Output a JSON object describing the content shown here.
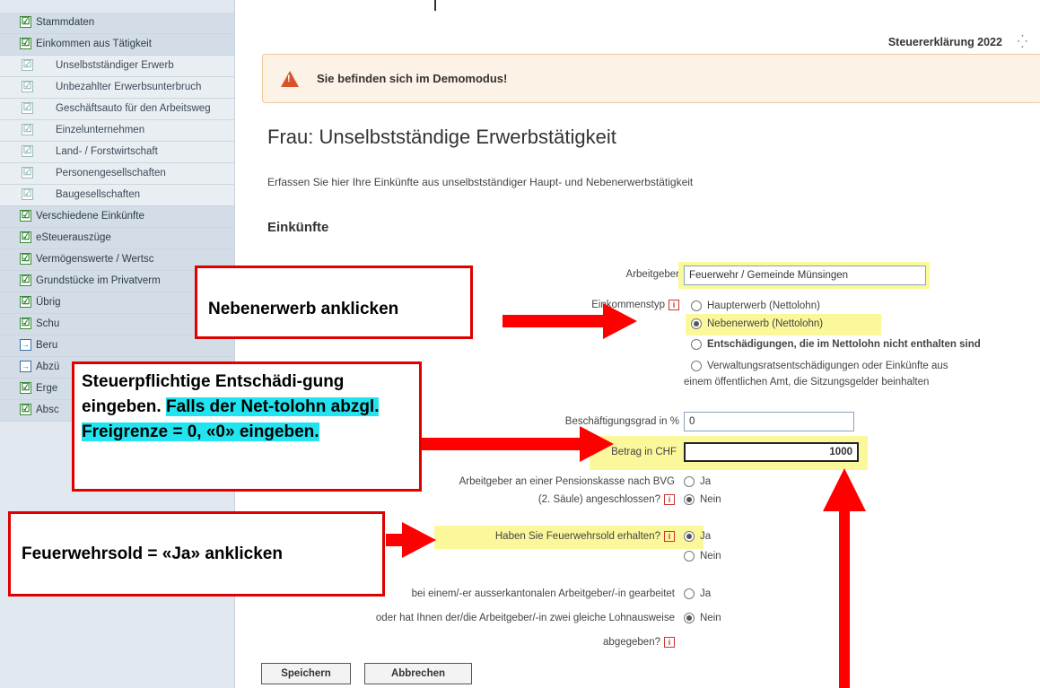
{
  "sidebar": {
    "items": [
      {
        "label": "Stammdaten",
        "level": "top",
        "mark": "☑"
      },
      {
        "label": "Einkommen aus Tätigkeit",
        "level": "top",
        "mark": "☑"
      },
      {
        "label": "Unselbstständiger Erwerb",
        "level": "sub",
        "mark": "☑"
      },
      {
        "label": "Unbezahlter Erwerbsunterbruch",
        "level": "sub",
        "mark": "☑"
      },
      {
        "label": "Geschäftsauto für den Arbeitsweg",
        "level": "sub",
        "mark": "☑"
      },
      {
        "label": "Einzelunternehmen",
        "level": "sub",
        "mark": "☑"
      },
      {
        "label": "Land- / Forstwirtschaft",
        "level": "sub",
        "mark": "☑"
      },
      {
        "label": "Personengesellschaften",
        "level": "sub",
        "mark": "☑"
      },
      {
        "label": "Baugesellschaften",
        "level": "sub",
        "mark": "☑"
      },
      {
        "label": "Verschiedene Einkünfte",
        "level": "top",
        "mark": "☑"
      },
      {
        "label": "eSteuerauszüge",
        "level": "top",
        "mark": "☑"
      },
      {
        "label": "Vermögenswerte / Wertsc",
        "level": "top",
        "mark": "☑"
      },
      {
        "label": "Grundstücke im Privatverm",
        "level": "top",
        "mark": "☑"
      },
      {
        "label": "Übrig",
        "level": "top",
        "mark": "☑"
      },
      {
        "label": "Schu",
        "level": "top",
        "mark": "☑"
      },
      {
        "label": "Beru",
        "level": "top",
        "mark": "→"
      },
      {
        "label": "Abzü",
        "level": "top",
        "mark": "→"
      },
      {
        "label": "Erge",
        "level": "top",
        "mark": "☑"
      },
      {
        "label": "Absc",
        "level": "top",
        "mark": "☑"
      }
    ]
  },
  "header": {
    "tax_title": "Steuererklärung 2022",
    "spinner": "⁛",
    "demo_message": "Sie befinden sich im Demomodus!",
    "warn_icon": "!"
  },
  "page": {
    "title": "Frau: Unselbstständige Erwerbstätigkeit",
    "intro": "Erfassen Sie hier Ihre Einkünfte aus unselbstständiger Haupt- und Nebenerwerbstätigkeit",
    "section": "Einkünfte"
  },
  "form": {
    "employer_label": "Arbeitgeber",
    "employer_value": "Feuerwehr / Gemeinde Münsingen",
    "income_type_label": "Einkommenstyp",
    "income_options": [
      "Haupterwerb (Nettolohn)",
      "Nebenerwerb (Nettolohn)",
      "Entschädigungen, die im Nettolohn nicht enthalten sind",
      "Verwaltungsratsentschädigungen oder Einkünfte aus",
      "einem öffentlichen Amt, die Sitzungsgelder beinhalten"
    ],
    "employment_label": "Beschäftigungsgrad in %",
    "employment_value": "0",
    "amount_label": "Betrag in CHF",
    "amount_value": "1000",
    "pension_label_1": "Arbeitgeber an einer Pensionskasse nach BVG",
    "pension_label_2": "(2. Säule) angeschlossen?",
    "fire_label": "Haben Sie Feuerwehrsold erhalten?",
    "intercantonal_label_1": "bei einem/-er ausserkantonalen Arbeitgeber/-in gearbeitet",
    "intercantonal_label_2": "oder hat Ihnen der/die Arbeitgeber/-in zwei gleiche Lohnausweise",
    "intercantonal_label_3": "abgegeben?",
    "yes": "Ja",
    "no": "Nein",
    "info": "i",
    "save": "Speichern",
    "cancel": "Abbrechen"
  },
  "annotations": {
    "callout1": "Nebenerwerb anklicken",
    "callout2_plain": "Steuerpflichtige Entschädi-gung eingeben. ",
    "callout2_highlight": "Falls der Net-tolohn abzgl. Freigrenze = 0, «0» eingeben.",
    "callout3": "Feuerwehrsold = «Ja» anklicken"
  },
  "colors": {
    "annotation_red": "#e00000",
    "highlight_yellow": "#fbf79b",
    "highlight_cyan": "#22e4f0",
    "sidebar_bg": "#e2e8ef"
  }
}
